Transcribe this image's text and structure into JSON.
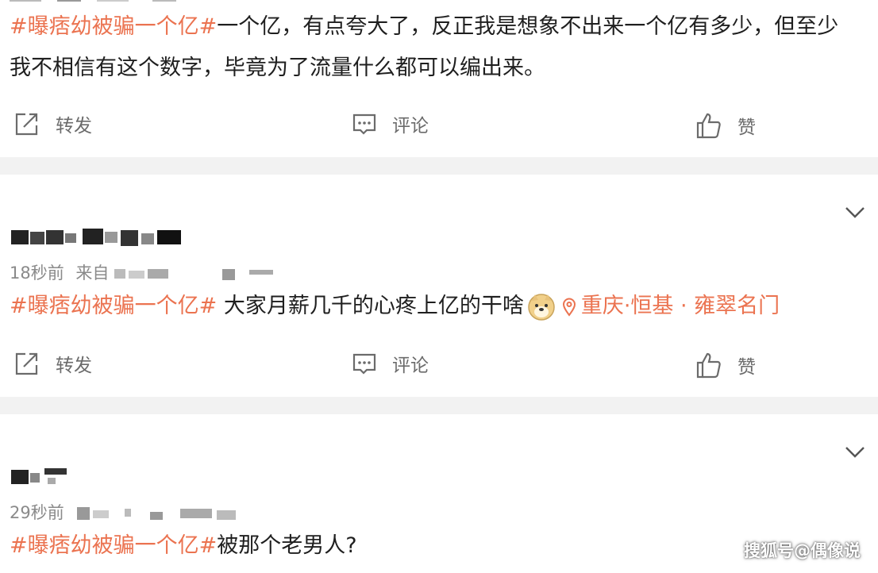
{
  "post1": {
    "tag": "#曝痞幼被骗一个亿#",
    "line1_rest": "一个亿，有点夸大了，反正我是想象不出来一个亿有多少，但至少",
    "line2": "我不相信有这个数字，毕竟为了流量什么都可以编出来。"
  },
  "post2": {
    "time": "18秒前",
    "source_prefix": "来自",
    "tag": "#曝痞幼被骗一个亿#",
    "body": " 大家月薪几千的心疼上亿的干啥",
    "location": "重庆·恒基 · 雍翠名门"
  },
  "post3": {
    "time": "29秒前",
    "tag": "#曝痞幼被骗一个亿#",
    "body": "被那个老男人?"
  },
  "actions": {
    "repost": "转发",
    "comment": "评论",
    "like": "赞"
  },
  "watermark": "搜狐号@偶像说",
  "colors": {
    "tag": "#eb7350",
    "meta": "#8a8a8a",
    "divider": "#f2f2f2",
    "icon": "#6b6b6b"
  },
  "icons": [
    "repost-icon",
    "comment-icon",
    "like-icon",
    "chevron-down-icon",
    "location-pin-icon",
    "doge-emoji-icon"
  ]
}
